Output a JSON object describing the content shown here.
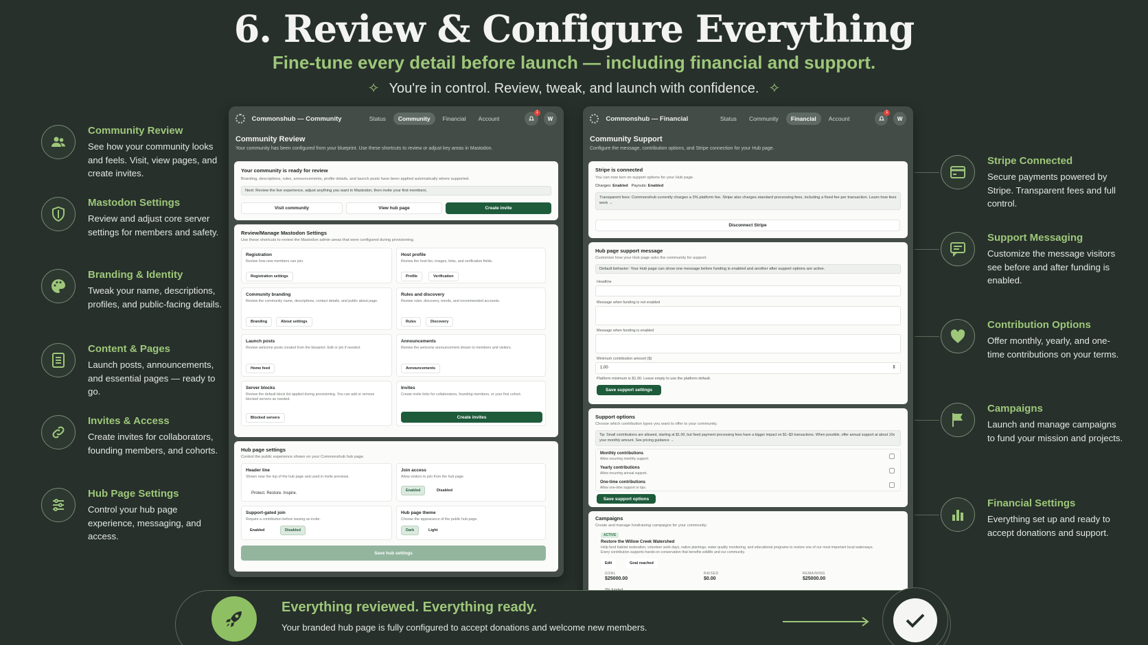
{
  "header": {
    "title": "6. Review & Configure Everything",
    "subtitle": "Fine-tune every detail before launch — including financial and support.",
    "tagline": "You're in control. Review, tweak, and launch with confidence."
  },
  "left_features": [
    {
      "icon": "users-icon",
      "title": "Community Review",
      "desc": "See how your community looks and feels. Visit, view pages, and create invites."
    },
    {
      "icon": "shield-icon",
      "title": "Mastodon Settings",
      "desc": "Review and adjust core server settings for members and safety."
    },
    {
      "icon": "palette-icon",
      "title": "Branding & Identity",
      "desc": "Tweak your name, descriptions, profiles, and public-facing details."
    },
    {
      "icon": "document-icon",
      "title": "Content & Pages",
      "desc": "Launch posts, announcements, and essential pages — ready to go."
    },
    {
      "icon": "link-icon",
      "title": "Invites & Access",
      "desc": "Create invites for collaborators, founding members, and cohorts."
    },
    {
      "icon": "sliders-icon",
      "title": "Hub Page Settings",
      "desc": "Control your hub page experience, messaging, and access."
    }
  ],
  "right_features": [
    {
      "icon": "credit-card-icon",
      "title": "Stripe Connected",
      "desc": "Secure payments powered by Stripe. Transparent fees and full control."
    },
    {
      "icon": "message-icon",
      "title": "Support Messaging",
      "desc": "Customize the message visitors see before and after funding is enabled."
    },
    {
      "icon": "heart-icon",
      "title": "Contribution Options",
      "desc": "Offer monthly, yearly, and one-time contributions on your terms."
    },
    {
      "icon": "flag-icon",
      "title": "Campaigns",
      "desc": "Launch and manage campaigns to fund your mission and projects."
    },
    {
      "icon": "bar-chart-icon",
      "title": "Financial Settings",
      "desc": "Everything set up and ready to accept donations and support."
    }
  ],
  "community_window": {
    "brand": "Commonshub — Community",
    "nav": [
      "Status",
      "Community",
      "Financial",
      "Account"
    ],
    "active_nav": "Community",
    "badge": "1",
    "avatar": "W",
    "title": "Community Review",
    "subtitle": "Your community has been configured from your blueprint. Use these shortcuts to review or adjust key areas in Mastodon.",
    "ready": {
      "title": "Your community is ready for review",
      "desc": "Branding, descriptions, rules, announcements, profile details, and launch posts have been applied automatically where supported.",
      "note": "Next: Review the live experience, adjust anything you want in Mastodon, then invite your first members.",
      "buttons": [
        "Visit community",
        "View hub page",
        "Create invite"
      ]
    },
    "manage": {
      "title": "Review/Manage Mastodon Settings",
      "desc": "Use these shortcuts to review the Mastodon admin areas that were configured during provisioning.",
      "items": [
        {
          "title": "Registration",
          "desc": "Review how new members can join.",
          "chips": [
            "Registration settings"
          ]
        },
        {
          "title": "Host profile",
          "desc": "Review the host bio, images, links, and verification fields.",
          "chips": [
            "Profile",
            "Verification"
          ]
        },
        {
          "title": "Community branding",
          "desc": "Review the community name, descriptions, contact details, and public about page.",
          "chips": [
            "Branding",
            "About settings"
          ]
        },
        {
          "title": "Rules and discovery",
          "desc": "Review rules, discovery, trends, and recommended accounts.",
          "chips": [
            "Rules",
            "Discovery"
          ]
        },
        {
          "title": "Launch posts",
          "desc": "Review welcome posts created from the blueprint. Edit or pin if needed.",
          "chips": [
            "Home feed"
          ]
        },
        {
          "title": "Announcements",
          "desc": "Review the welcome announcement shown to members and visitors.",
          "chips": [
            "Announcements"
          ]
        },
        {
          "title": "Server blocks",
          "desc": "Review the default block list applied during provisioning. You can add or remove blocked servers as needed.",
          "chips": [
            "Blocked servers"
          ]
        },
        {
          "title": "Invites",
          "desc": "Create invite links for collaborators, founding members, or your first cohort.",
          "button": "Create invites"
        }
      ]
    },
    "hub": {
      "title": "Hub page settings",
      "desc": "Control the public experience shown on your Commonshub hub page.",
      "header_line": {
        "title": "Header line",
        "desc": "Shown near the top of the hub page and used in invite previews.",
        "value": "Protect. Restore. Inspire."
      },
      "join_access": {
        "title": "Join access",
        "desc": "Allow visitors to join from the hub page.",
        "options": [
          "Enabled",
          "Disabled"
        ],
        "selected": "Enabled"
      },
      "support_gated": {
        "title": "Support-gated join",
        "desc": "Require a contribution before issuing an invite.",
        "options": [
          "Enabled",
          "Disabled"
        ],
        "selected": "Disabled"
      },
      "theme": {
        "title": "Hub page theme",
        "desc": "Choose the appearance of the public hub page.",
        "options": [
          "Dark",
          "Light"
        ],
        "selected": "Dark"
      },
      "save": "Save hub settings"
    }
  },
  "financial_window": {
    "brand": "Commonshub — Financial",
    "nav": [
      "Status",
      "Community",
      "Financial",
      "Account"
    ],
    "active_nav": "Financial",
    "badge": "1",
    "avatar": "W",
    "title": "Community Support",
    "subtitle": "Configure the message, contribution options, and Stripe connection for your Hub page.",
    "stripe": {
      "title": "Stripe is connected",
      "desc": "You can now turn on support options for your Hub page.",
      "charges_label": "Charges:",
      "charges": "Enabled",
      "payouts_label": "Payouts:",
      "payouts": "Enabled",
      "fees": "Transparent fees: Commonshub currently charges a 3% platform fee. Stripe also charges standard processing fees, including a fixed fee per transaction. Learn how fees work →",
      "disconnect": "Disconnect Stripe"
    },
    "message": {
      "title": "Hub page support message",
      "desc": "Customize how your Hub page asks the community for support.",
      "note": "Default behavior: Your Hub page can show one message before funding is enabled and another after support options are active.",
      "headline_label": "Headline",
      "not_enabled_label": "Message when funding is not enabled",
      "enabled_label": "Message when funding is enabled",
      "min_label": "Minimum contribution amount ($)",
      "min_value": "1.00",
      "min_hint": "Platform minimum is $1.00. Leave empty to use the platform default.",
      "save": "Save support settings"
    },
    "options": {
      "title": "Support options",
      "desc": "Choose which contribution types you want to offer to your community.",
      "tip": "Tip: Small contributions are allowed, starting at $1.00, but fixed payment processing fees have a bigger impact on $1–$3 transactions. When possible, offer annual support at about 10x your monthly amount. See pricing guidance →",
      "items": [
        {
          "title": "Monthly contributions",
          "desc": "Allow recurring monthly support."
        },
        {
          "title": "Yearly contributions",
          "desc": "Allow recurring annual support."
        },
        {
          "title": "One-time contributions",
          "desc": "Allow one-time support or tips."
        }
      ],
      "save": "Save support options"
    },
    "campaigns": {
      "title": "Campaigns",
      "desc": "Create and manage fundraising campaigns for your community.",
      "status": "ACTIVE",
      "name": "Restore the Willow Creek Watershed",
      "body": "Help fund habitat restoration, volunteer work days, native plantings, water quality monitoring, and educational programs to restore one of our most important local waterways. Every contribution supports hands-on conservation that benefits wildlife and our community.",
      "edit": "Edit",
      "goal_reached": "Goal reached",
      "goal_label": "GOAL",
      "goal": "$25000.00",
      "raised_label": "RAISED",
      "raised": "$0.00",
      "remaining_label": "REMAINING",
      "remaining": "$25000.00",
      "funded": "0% funded"
    }
  },
  "banner": {
    "title": "Everything reviewed. Everything ready.",
    "subtitle": "Your branded hub page is fully configured to accept donations and welcome new members."
  },
  "colors": {
    "background": "#27302b",
    "accent": "#9ec77a",
    "primary_button": "#1e5b3b"
  }
}
